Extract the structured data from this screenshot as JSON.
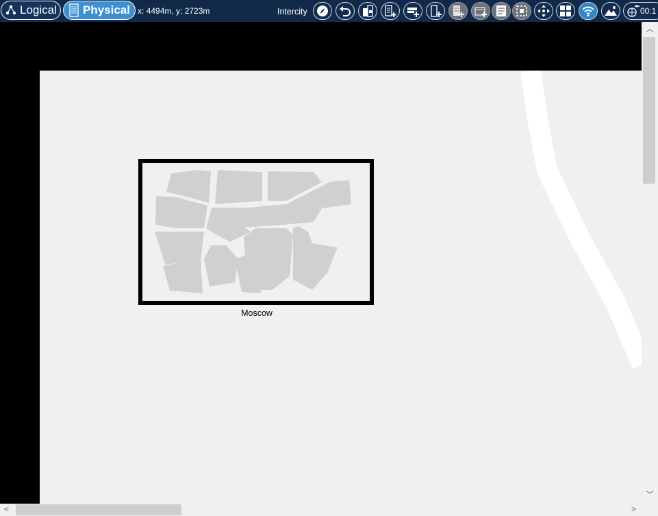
{
  "toolbar": {
    "logical_label": "Logical",
    "physical_label": "Physical",
    "coords": "x: 4494m, y: 2723m",
    "intercity_label": "Intercity",
    "clock": "00:1"
  },
  "icons": [
    "logical-network-icon",
    "physical-building-icon",
    "compass-icon",
    "undo-icon",
    "building-icon",
    "add-floor-icon",
    "add-rack-icon",
    "add-device-icon",
    "add-server-icon",
    "add-wiring-closet-icon",
    "inventory-icon",
    "select-area-icon",
    "move-icon",
    "grid-icon",
    "wireless-icon",
    "background-image-icon",
    "environment-icon"
  ],
  "canvas": {
    "city_label": "Moscow"
  },
  "colors": {
    "toolbar_bg": "#112a4a",
    "physical_active": "#3c8fd0",
    "canvas_bg": "#000000",
    "region_bg": "#f0f0f0",
    "city_blocks": "#d0d0d0"
  }
}
